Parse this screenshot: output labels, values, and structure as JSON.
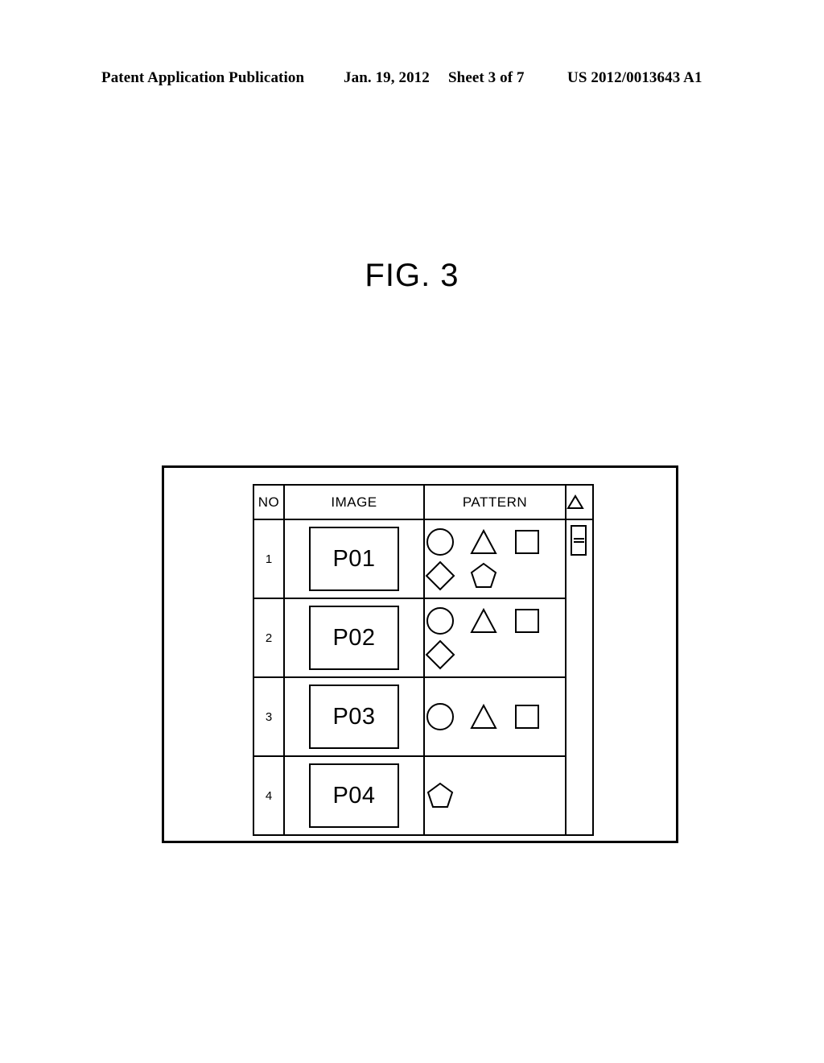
{
  "header": {
    "publication": "Patent Application Publication",
    "date": "Jan. 19, 2012",
    "sheet": "Sheet 3 of 7",
    "number": "US 2012/0013643 A1"
  },
  "figure": {
    "title": "FIG. 3"
  },
  "table": {
    "columns": [
      {
        "key": "no",
        "label": "NO"
      },
      {
        "key": "image",
        "label": "IMAGE"
      },
      {
        "key": "pattern",
        "label": "PATTERN"
      },
      {
        "key": "scroll",
        "label": "",
        "icon": "triangle-up-icon"
      }
    ],
    "rows": [
      {
        "no": "1",
        "image_label": "P01",
        "pattern_shapes": [
          "circle",
          "triangle",
          "square",
          "diamond",
          "pentagon"
        ]
      },
      {
        "no": "2",
        "image_label": "P02",
        "pattern_shapes": [
          "circle",
          "triangle",
          "square",
          "diamond"
        ]
      },
      {
        "no": "3",
        "image_label": "P03",
        "pattern_shapes": [
          "circle",
          "triangle",
          "square"
        ]
      },
      {
        "no": "4",
        "image_label": "P04",
        "pattern_shapes": [
          "pentagon"
        ]
      }
    ]
  },
  "scrollbar": {
    "up_arrow_icon": "triangle-up-icon",
    "thumb_icon": "grip-lines-icon",
    "thumb_position": "top"
  },
  "colors": {
    "ink": "#000000",
    "paper": "#ffffff"
  }
}
